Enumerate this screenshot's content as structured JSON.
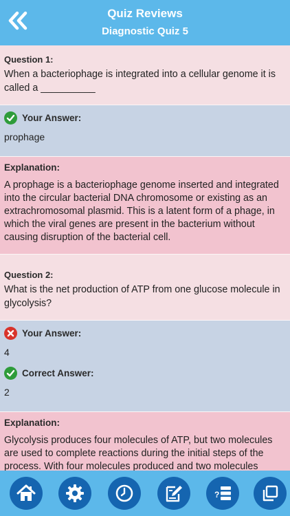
{
  "header": {
    "title": "Quiz Reviews",
    "subtitle": "Diagnostic Quiz 5"
  },
  "questions": [
    {
      "label": "Question 1:",
      "text": "When a bacteriophage is integrated into a cellular genome it is called a __________",
      "your_answer_label": "Your Answer:",
      "your_answer": "prophage",
      "your_answer_correct": true,
      "explanation_label": "Explanation:",
      "explanation": "A prophage is a bacteriophage genome inserted and integrated into the circular bacterial DNA chromosome or existing as an extrachromosomal plasmid. This is a latent form of a phage, in which the viral genes are present in the bacterium without causing disruption of the bacterial cell."
    },
    {
      "label": "Question 2:",
      "text": "What is the net production of ATP from one glucose molecule in glycolysis?",
      "your_answer_label": "Your Answer:",
      "your_answer": "4",
      "your_answer_correct": false,
      "correct_answer_label": "Correct Answer:",
      "correct_answer": "2",
      "explanation_label": "Explanation:",
      "explanation": "Glycolysis produces four molecules of ATP, but two molecules are used to complete reactions during the initial steps of the process. With four molecules produced and two molecules consumed in the process, there is a net yield of two ATP from each glucose molecule in glycolysisDuring ATP synthesis in the"
    }
  ],
  "toolbar": {
    "icons": [
      "home-icon",
      "gear-icon",
      "clock-icon",
      "edit-icon",
      "quiz-list-icon",
      "copy-icon"
    ]
  },
  "colors": {
    "accent": "#5cb8ea",
    "button": "#1565b0",
    "question_bg": "#f5dfe3",
    "answer_bg": "#c7d3e4",
    "explanation_bg": "#f2c3cf",
    "correct": "#2e9c3a",
    "wrong": "#d8342b"
  }
}
